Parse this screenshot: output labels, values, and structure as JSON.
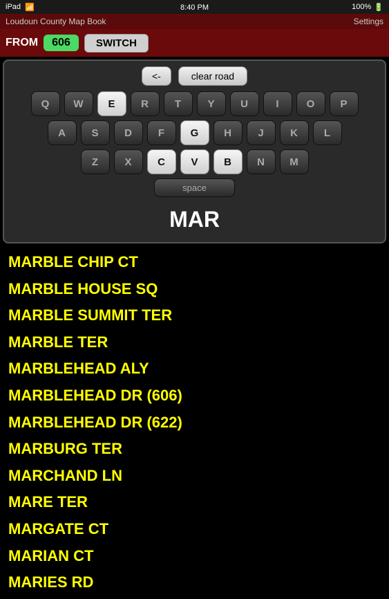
{
  "statusBar": {
    "left": "iPad",
    "time": "8:40 PM",
    "right": "100%"
  },
  "titleBar": {
    "appTitle": "Loudoun County Map Book",
    "settingsLabel": "Settings"
  },
  "toolbar": {
    "fromLabel": "FROM",
    "pageNumber": "606",
    "switchLabel": "SWITCH"
  },
  "keyboard": {
    "backLabel": "<-",
    "clearLabel": "clear road",
    "rows": [
      [
        "Q",
        "W",
        "E",
        "R",
        "T",
        "Y",
        "U",
        "I",
        "O",
        "P"
      ],
      [
        "A",
        "S",
        "D",
        "F",
        "G",
        "H",
        "J",
        "K",
        "L"
      ],
      [
        "Z",
        "X",
        "C",
        "V",
        "B",
        "N",
        "M"
      ]
    ],
    "spaceLabel": "space",
    "currentInput": "MAR"
  },
  "streets": [
    "MARBLE CHIP CT",
    "MARBLE HOUSE SQ",
    "MARBLE SUMMIT TER",
    "MARBLE TER",
    "MARBLEHEAD ALY",
    "MARBLEHEAD DR (606)",
    "MARBLEHEAD DR (622)",
    "MARBURG TER",
    "MARCHAND LN",
    "MARE TER",
    "MARGATE CT",
    "MARIAN CT",
    "MARIES RD"
  ]
}
